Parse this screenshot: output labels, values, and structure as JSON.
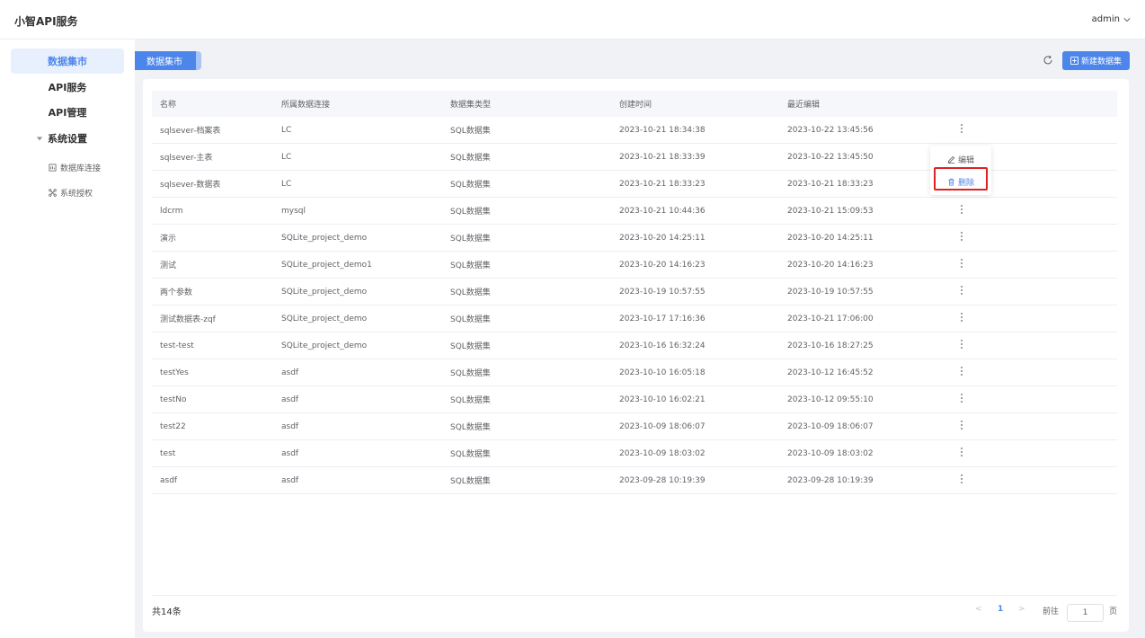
{
  "header": {
    "app_title": "小智API服务",
    "user": "admin"
  },
  "sidebar": {
    "items": [
      {
        "label": "数据集市"
      },
      {
        "label": "API服务"
      },
      {
        "label": "API管理"
      }
    ],
    "group": {
      "label": "系统设置",
      "children": [
        {
          "label": "数据库连接",
          "icon": "database-icon"
        },
        {
          "label": "系统授权",
          "icon": "authorization-icon"
        }
      ]
    }
  },
  "page": {
    "tag": "数据集市",
    "new_button": "新建数据集"
  },
  "table": {
    "columns": [
      "名称",
      "所属数据连接",
      "数据集类型",
      "创建时间",
      "最近编辑"
    ],
    "rows": [
      [
        "sqlsever-档案表",
        "LC",
        "SQL数据集",
        "2023-10-21 18:34:38",
        "2023-10-22 13:45:56"
      ],
      [
        "sqlsever-主表",
        "LC",
        "SQL数据集",
        "2023-10-21 18:33:39",
        "2023-10-22 13:45:50"
      ],
      [
        "sqlsever-数据表",
        "LC",
        "SQL数据集",
        "2023-10-21 18:33:23",
        "2023-10-21 18:33:23"
      ],
      [
        "ldcrm",
        "mysql",
        "SQL数据集",
        "2023-10-21 10:44:36",
        "2023-10-21 15:09:53"
      ],
      [
        "演示",
        "SQLite_project_demo",
        "SQL数据集",
        "2023-10-20 14:25:11",
        "2023-10-20 14:25:11"
      ],
      [
        "测试",
        "SQLite_project_demo1",
        "SQL数据集",
        "2023-10-20 14:16:23",
        "2023-10-20 14:16:23"
      ],
      [
        "两个参数",
        "SQLite_project_demo",
        "SQL数据集",
        "2023-10-19 10:57:55",
        "2023-10-19 10:57:55"
      ],
      [
        "测试数据表-zqf",
        "SQLite_project_demo",
        "SQL数据集",
        "2023-10-17 17:16:36",
        "2023-10-21 17:06:00"
      ],
      [
        "test-test",
        "SQLite_project_demo",
        "SQL数据集",
        "2023-10-16 16:32:24",
        "2023-10-16 18:27:25"
      ],
      [
        "testYes",
        "asdf",
        "SQL数据集",
        "2023-10-10 16:05:18",
        "2023-10-12 16:45:52"
      ],
      [
        "testNo",
        "asdf",
        "SQL数据集",
        "2023-10-10 16:02:21",
        "2023-10-12 09:55:10"
      ],
      [
        "test22",
        "asdf",
        "SQL数据集",
        "2023-10-09 18:06:07",
        "2023-10-09 18:06:07"
      ],
      [
        "test",
        "asdf",
        "SQL数据集",
        "2023-10-09 18:03:02",
        "2023-10-09 18:03:02"
      ],
      [
        "asdf",
        "asdf",
        "SQL数据集",
        "2023-09-28 10:19:39",
        "2023-09-28 10:19:39"
      ]
    ]
  },
  "dropdown": {
    "edit": "编辑",
    "delete": "删除"
  },
  "pagination": {
    "total": "共14条",
    "current": "1",
    "goto": "前往",
    "input_value": "1",
    "suffix": "页"
  }
}
